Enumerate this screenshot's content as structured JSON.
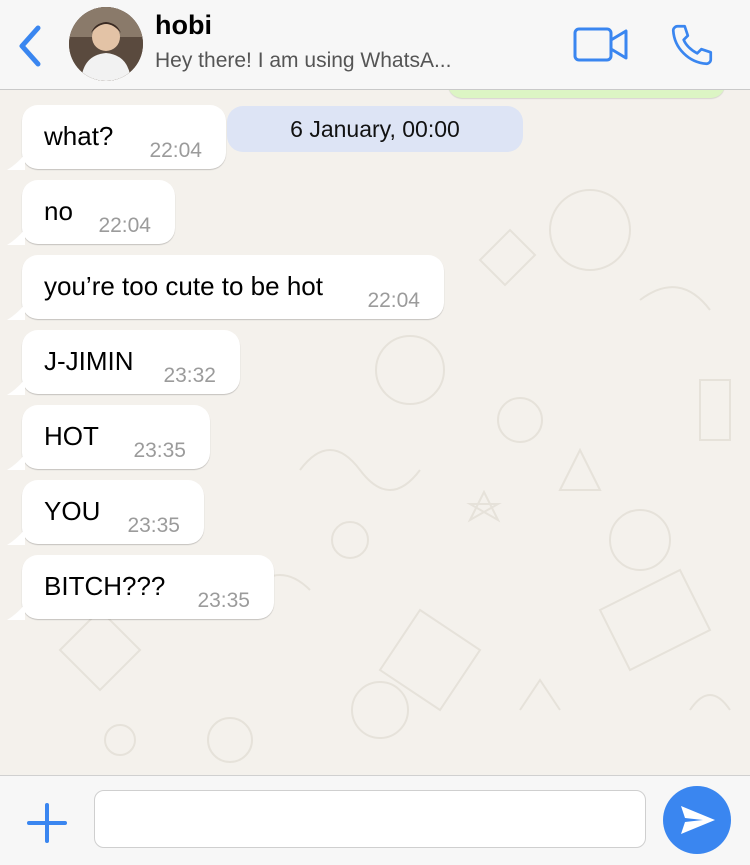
{
  "header": {
    "contact_name": "hobi",
    "status": "Hey there! I am using WhatsA...",
    "icons": [
      "back-chevron-icon",
      "avatar",
      "video-call-icon",
      "phone-icon"
    ],
    "accent_color": "#3a86f0"
  },
  "chat": {
    "date_separator": "6 January, 00:00",
    "messages": [
      {
        "text": "what?",
        "time": "22:04"
      },
      {
        "text": "no",
        "time": "22:04"
      },
      {
        "text": "you’re too cute to be hot",
        "time": "22:04"
      },
      {
        "text": "J-JIMIN",
        "time": "23:32"
      },
      {
        "text": "HOT",
        "time": "23:35"
      },
      {
        "text": "YOU",
        "time": "23:35"
      },
      {
        "text": "BITCH???",
        "time": "23:35"
      }
    ]
  },
  "composer": {
    "input_value": "",
    "icons": [
      "plus-icon",
      "send-icon"
    ]
  }
}
